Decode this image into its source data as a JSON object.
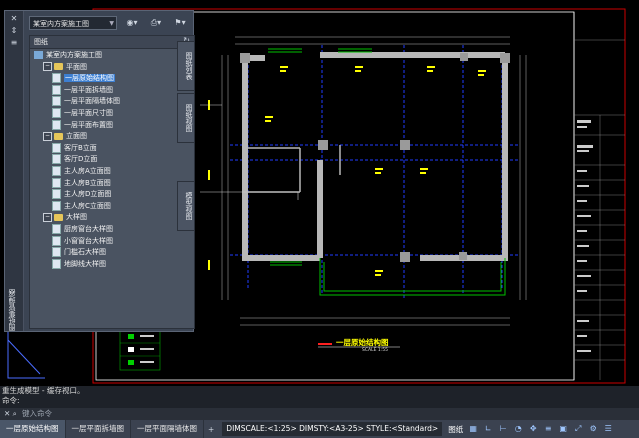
{
  "palette": {
    "vertical_title": "图纸集管理器",
    "sheetset": "某室内方案施工图",
    "panel_title": "图纸",
    "tree": [
      {
        "label": "某室内方案施工图",
        "level": 0,
        "kind": "root"
      },
      {
        "label": "平面图",
        "level": 1,
        "kind": "folder",
        "toggle": "−"
      },
      {
        "label": "一层原始结构图",
        "level": 2,
        "kind": "sheet",
        "selected": true
      },
      {
        "label": "一层平面拆墙图",
        "level": 2,
        "kind": "sheet"
      },
      {
        "label": "一层平面隔墙体图",
        "level": 2,
        "kind": "sheet"
      },
      {
        "label": "一层平面尺寸图",
        "level": 2,
        "kind": "sheet"
      },
      {
        "label": "一层平面布置图",
        "level": 2,
        "kind": "sheet"
      },
      {
        "label": "立面图",
        "level": 1,
        "kind": "folder",
        "toggle": "−"
      },
      {
        "label": "客厅B立面",
        "level": 2,
        "kind": "sheet"
      },
      {
        "label": "客厅D立面",
        "level": 2,
        "kind": "sheet"
      },
      {
        "label": "主人房A立面图",
        "level": 2,
        "kind": "sheet"
      },
      {
        "label": "主人房B立面图",
        "level": 2,
        "kind": "sheet"
      },
      {
        "label": "主人房D立面图",
        "level": 2,
        "kind": "sheet"
      },
      {
        "label": "主人房C立面图",
        "level": 2,
        "kind": "sheet"
      },
      {
        "label": "大样图",
        "level": 1,
        "kind": "folder",
        "toggle": "−"
      },
      {
        "label": "厨房窗台大样图",
        "level": 2,
        "kind": "sheet"
      },
      {
        "label": "小窗窗台大样图",
        "level": 2,
        "kind": "sheet"
      },
      {
        "label": "门槛石大样图",
        "level": 2,
        "kind": "sheet"
      },
      {
        "label": "地脚线大样图",
        "level": 2,
        "kind": "sheet"
      }
    ],
    "side_tabs": [
      "图纸列表",
      "图纸视图",
      "模型视图"
    ]
  },
  "drawing": {
    "title": "一层原始结构图",
    "scale": "SCALE 1:55"
  },
  "command": {
    "history": [
      "重生成模型 - 缓存视口。",
      "命令:"
    ],
    "input_placeholder": "键入命令"
  },
  "status": {
    "layout_tabs": [
      "一层原始结构图",
      "一层平面拆墙图",
      "一层平面隔墙体图"
    ],
    "active_tab": 0,
    "scale_text": "DIMSCALE:<1:25> DIMSTY:<A3-25> STYLE:<Standard>",
    "model_label": "图纸"
  },
  "colors": {
    "accent": "#3d7fd1",
    "wall": "#b8b8b8",
    "dim": "#ffff00",
    "axis": "#1f3bff",
    "frame": "#cc0000",
    "green": "#00b000"
  }
}
